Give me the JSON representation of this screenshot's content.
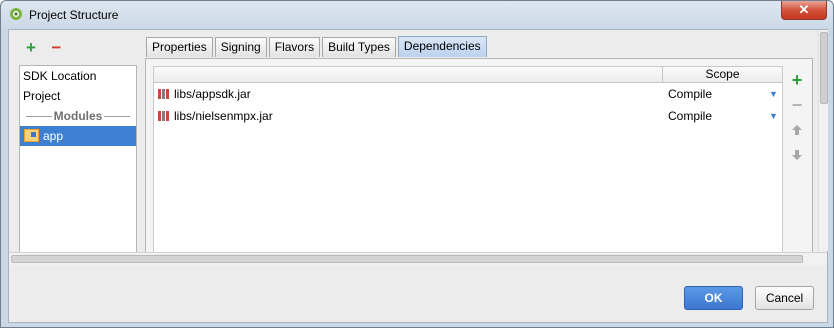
{
  "window": {
    "title": "Project Structure",
    "close_label": "✕"
  },
  "left_toolbar": {
    "add_label": "+",
    "remove_label": "−"
  },
  "sidebar": {
    "items": [
      {
        "label": "SDK Location"
      },
      {
        "label": "Project"
      }
    ],
    "modules_header": "Modules",
    "modules": [
      {
        "label": "app",
        "selected": true
      }
    ]
  },
  "tabs": [
    {
      "label": "Properties",
      "active": false
    },
    {
      "label": "Signing",
      "active": false
    },
    {
      "label": "Flavors",
      "active": false
    },
    {
      "label": "Build Types",
      "active": false
    },
    {
      "label": "Dependencies",
      "active": true
    }
  ],
  "dependencies": {
    "columns": {
      "dependency": "",
      "scope": "Scope"
    },
    "rows": [
      {
        "name": "libs/appsdk.jar",
        "scope": "Compile"
      },
      {
        "name": "libs/nielsenmpx.jar",
        "scope": "Compile"
      }
    ]
  },
  "right_toolbar": {
    "add_label": "+",
    "remove_label": "−",
    "up_label": "🡅",
    "down_label": "🡇"
  },
  "footer": {
    "ok_label": "OK",
    "cancel_label": "Cancel"
  },
  "colors": {
    "selection": "#3d80d1",
    "add_green": "#2f9e3a",
    "remove_red": "#d23b2a",
    "ok_blue": "#3c76d1"
  },
  "icons": {
    "title": "android-studio-icon",
    "module": "module-icon",
    "jar": "jar-library-icon"
  }
}
